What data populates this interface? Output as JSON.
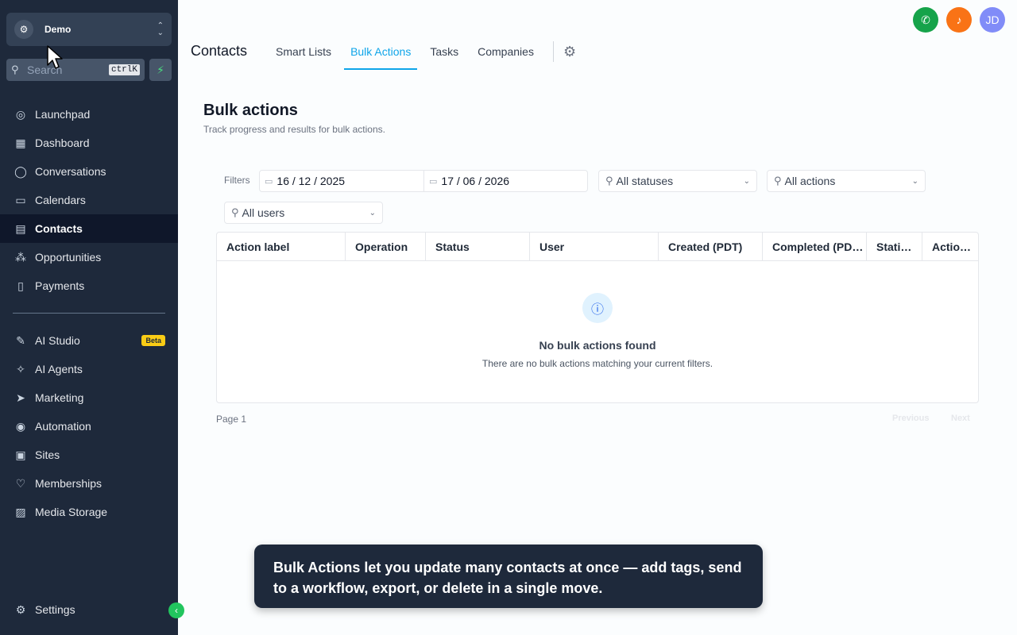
{
  "sidebar": {
    "account_name": "Demo",
    "search_placeholder": "Search",
    "search_shortcut": "ctrlK",
    "nav": [
      {
        "label": "Launchpad",
        "icon": "rocket-icon"
      },
      {
        "label": "Dashboard",
        "icon": "grid-icon"
      },
      {
        "label": "Conversations",
        "icon": "chat-icon"
      },
      {
        "label": "Calendars",
        "icon": "calendar-icon"
      },
      {
        "label": "Contacts",
        "icon": "contacts-icon",
        "active": true
      },
      {
        "label": "Opportunities",
        "icon": "opportunities-icon"
      },
      {
        "label": "Payments",
        "icon": "payments-icon"
      }
    ],
    "nav2": [
      {
        "label": "AI Studio",
        "icon": "ai-studio-icon",
        "badge": "Beta"
      },
      {
        "label": "AI Agents",
        "icon": "sparkle-icon"
      },
      {
        "label": "Marketing",
        "icon": "send-icon"
      },
      {
        "label": "Automation",
        "icon": "automation-icon"
      },
      {
        "label": "Sites",
        "icon": "sites-icon"
      },
      {
        "label": "Memberships",
        "icon": "memberships-icon"
      },
      {
        "label": "Media Storage",
        "icon": "image-icon"
      }
    ],
    "settings_label": "Settings"
  },
  "header": {
    "avatar_initials": "JD",
    "title": "Contacts",
    "tabs": [
      "Smart Lists",
      "Bulk Actions",
      "Tasks",
      "Companies"
    ],
    "active_tab": "Bulk Actions"
  },
  "main": {
    "heading": "Bulk actions",
    "subheading": "Track progress and results for bulk actions.",
    "filters_label": "Filters",
    "date_from": "16 / 12 / 2025",
    "date_to": "17 / 06 / 2026",
    "status_filter": "All statuses",
    "action_filter": "All actions",
    "user_filter": "All users",
    "columns": [
      "Action label",
      "Operation",
      "Status",
      "User",
      "Created (PDT)",
      "Completed (PD…",
      "Stati…",
      "Actio…"
    ],
    "empty_title": "No bulk actions found",
    "empty_desc": "There are no bulk actions matching your current filters.",
    "page_label": "Page 1",
    "prev_label": "Previous",
    "next_label": "Next"
  },
  "tooltip": {
    "text": "Bulk Actions let you update many contacts at once — add tags, send to a workflow, export, or delete in a single move."
  },
  "colors": {
    "sidebar_bg": "#1e293b",
    "accent": "#0ea5e9",
    "phone": "#16a34a",
    "bell": "#f97316",
    "badge": "#facc15"
  }
}
